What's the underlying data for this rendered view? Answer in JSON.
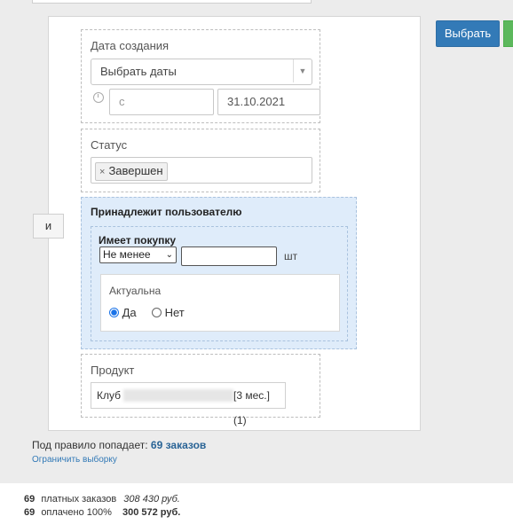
{
  "header_buttons": {
    "select_label": "Выбрать"
  },
  "creation_date": {
    "label": "Дата создания",
    "range_select": "Выбрать даты",
    "from_placeholder": "с",
    "to_value": "31.10.2021"
  },
  "status": {
    "label": "Статус",
    "tag": "Завершен",
    "tag_remove": "×"
  },
  "join_operator": "и",
  "belongs_to_user": {
    "title": "Принадлежит пользователю",
    "has_purchase": {
      "title": "Имеет покупку",
      "comparison": "Не менее",
      "quantity_value": "",
      "unit": "шт",
      "actual": {
        "label": "Актуальна",
        "options": [
          {
            "label": "Да",
            "checked": true
          },
          {
            "label": "Нет",
            "checked": false
          }
        ]
      }
    }
  },
  "product": {
    "label": "Продукт",
    "value_prefix": "Клуб",
    "value_suffix": "[3 мес.] (1)"
  },
  "rule_summary": {
    "text": "Под правило попадает:",
    "count": "69 заказов",
    "limit_link": "Ограничить выборку"
  },
  "stats": [
    {
      "count": "69",
      "label": "платных заказов",
      "amount": "308 430 руб."
    },
    {
      "count": "69",
      "label": "оплачено 100%",
      "amount": "300 572 руб."
    }
  ],
  "colors": {
    "primary": "#337ab7",
    "success": "#5cb85c",
    "group_bg": "#dfecfa",
    "link": "#2a6496"
  }
}
